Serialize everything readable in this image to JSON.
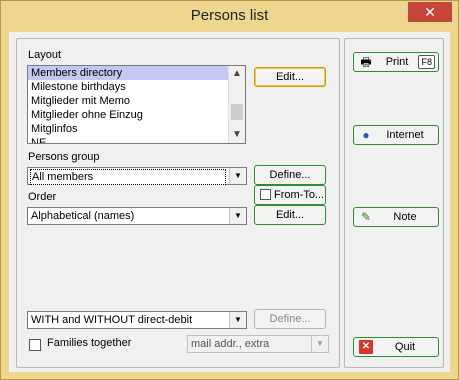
{
  "window": {
    "title": "Persons list",
    "close_label": "✕"
  },
  "layout": {
    "label": "Layout",
    "items": [
      "Members directory",
      "Milestone birthdays",
      "Mitglieder mit Memo",
      "Mitglieder ohne Einzug",
      "Mitglinfos",
      "NE"
    ],
    "selected": "Members directory",
    "edit_button": "Edit..."
  },
  "persons_group": {
    "label": "Persons group",
    "value": "All members",
    "define_button": "Define...",
    "from_to_label": "From-To..."
  },
  "order": {
    "label": "Order",
    "value": "Alphabetical (names)",
    "edit_button": "Edit..."
  },
  "debit": {
    "value": "WITH and WITHOUT direct-debit",
    "define_button": "Define..."
  },
  "families": {
    "label": "Families together",
    "checked": false
  },
  "mail": {
    "value": "mail addr., extra"
  },
  "sidebar": {
    "print_label": "Print",
    "print_key": "F8",
    "internet_label": "Internet",
    "note_label": "Note",
    "quit_label": "Quit"
  }
}
